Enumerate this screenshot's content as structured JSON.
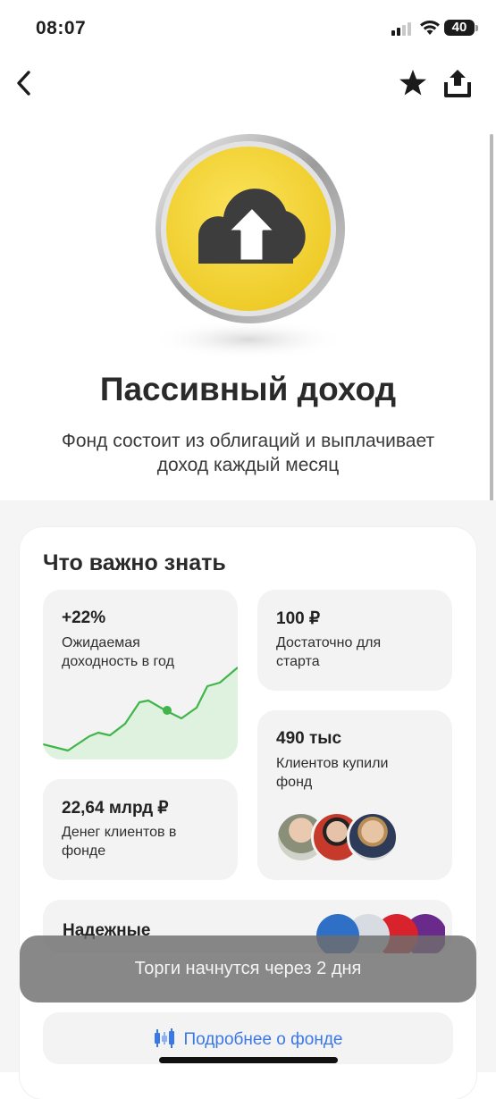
{
  "status_bar": {
    "time": "08:07",
    "battery": "40"
  },
  "nav": {
    "back_icon": "chevron-left-icon",
    "star_icon": "star-icon",
    "share_icon": "share-icon"
  },
  "hero": {
    "icon": "cloud-arrow-up-icon",
    "coin_color": "#f6d73e"
  },
  "fund": {
    "title": "Пассивный доход",
    "subtitle": "Фонд состоит из облигаций и выплачивает доход каждый месяц"
  },
  "important": {
    "title": "Что важно знать",
    "yield": {
      "value": "+22%",
      "label": "Ожидаемая доходность в год"
    },
    "min_start": {
      "value": "100 ₽",
      "label": "Достаточно для старта"
    },
    "clients": {
      "value": "490 тыс",
      "label": "Клиентов купили фонд"
    },
    "assets": {
      "value": "22,64 млрд ₽",
      "label": "Денег клиентов в фонде"
    },
    "reliable": {
      "label": "Надежные"
    }
  },
  "toast": {
    "text": "Торги начнутся через 2 дня"
  },
  "more_button": {
    "label": "Подробнее о фонде",
    "icon": "candlestick-icon"
  },
  "colors": {
    "accent": "#3b78e7",
    "chart_line": "#3fb54a",
    "chart_fill": "#dff2df"
  }
}
